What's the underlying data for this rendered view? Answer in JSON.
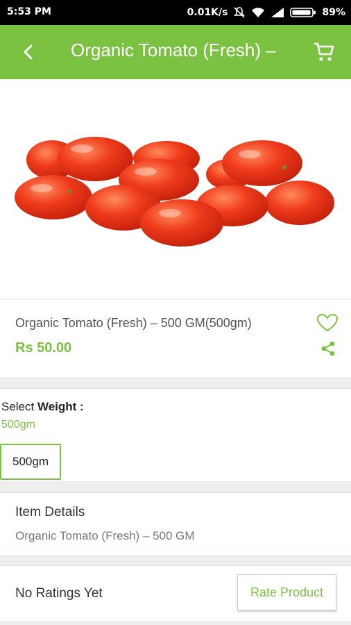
{
  "status_bar": {
    "time": "5:53 PM",
    "network_speed": "0.01K/s",
    "battery": "89%",
    "icons": [
      "mute-icon",
      "wifi-icon",
      "signal-icon",
      "battery-icon"
    ]
  },
  "app_bar": {
    "title": "Organic Tomato (Fresh) –",
    "back_icon": "back-arrow-icon",
    "cart_icon": "cart-icon"
  },
  "product": {
    "image_icon": "cherry-tomatoes-image",
    "name": "Organic Tomato (Fresh) – 500 GM(500gm)",
    "price": "Rs  50.00",
    "favorite_icon": "heart-outline-icon",
    "share_icon": "share-icon"
  },
  "weight": {
    "label_prefix": "Select ",
    "label_bold": "Weight :",
    "selected_value": "500gm",
    "options": [
      "500gm"
    ]
  },
  "item_details": {
    "title": "Item Details",
    "text": "Organic Tomato (Fresh) – 500 GM"
  },
  "ratings": {
    "text": "No Ratings Yet",
    "button_label": "Rate Product"
  },
  "colors": {
    "accent": "#7cc242",
    "status_bar": "#000000",
    "divider": "#eeeeee"
  }
}
